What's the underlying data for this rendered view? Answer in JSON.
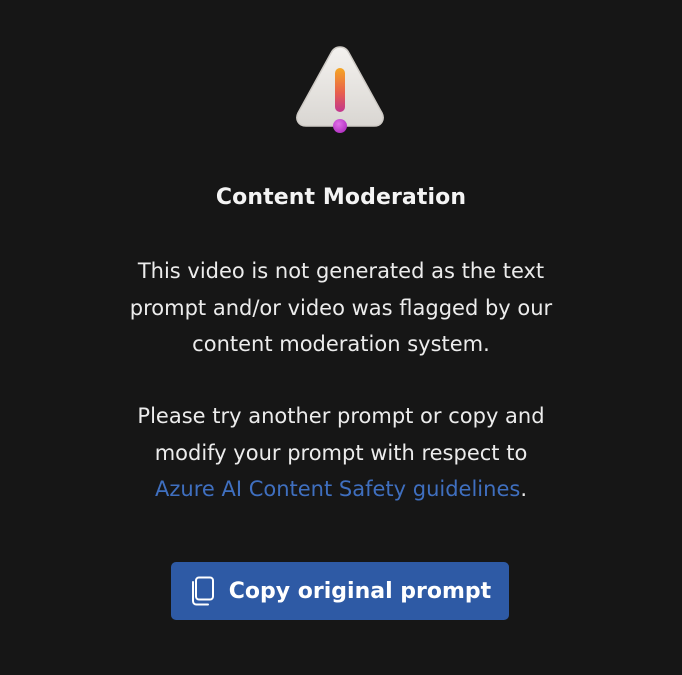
{
  "dialog": {
    "icon": "warning-triangle-icon",
    "title": "Content Moderation",
    "message": {
      "line1": "This video is not generated as the text",
      "line2": "prompt and/or video was flagged by our",
      "line3": "content moderation system."
    },
    "guidance": {
      "line1": "Please try another prompt or copy and",
      "line2": "modify your prompt with respect to",
      "link_text": "Azure AI Content Safety guidelines",
      "trailing": "."
    },
    "copy_button": {
      "icon": "copy-icon",
      "label": "Copy original prompt"
    }
  },
  "colors": {
    "background": "#161616",
    "link": "#3f6fbf",
    "button": "#2e5aa5",
    "text": "#ececec"
  }
}
